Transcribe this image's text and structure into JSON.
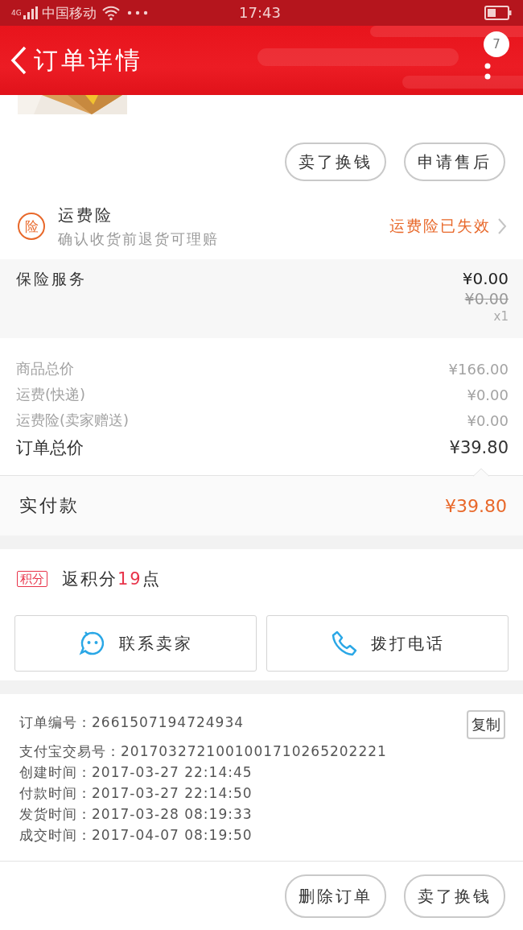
{
  "status_bar": {
    "network": "4G",
    "carrier": "中国移动",
    "time": "17:43"
  },
  "header": {
    "title": "订单详情",
    "badge": "7"
  },
  "top_actions": [
    "卖了换钱",
    "申请售后"
  ],
  "shipping_insurance": {
    "badge": "险",
    "title": "运费险",
    "subtitle": "确认收货前退货可理赔",
    "status": "运费险已失效"
  },
  "insurance_service": {
    "label": "保险服务",
    "price": "¥0.00",
    "original_price": "¥0.00",
    "quantity": "x1"
  },
  "price_lines": [
    {
      "label": "商品总价",
      "value": "¥166.00",
      "kind": "minor"
    },
    {
      "label": "运费(快递)",
      "value": "¥0.00",
      "kind": "minor"
    },
    {
      "label": "运费险(卖家赠送)",
      "value": "¥0.00",
      "kind": "minor"
    },
    {
      "label": "订单总价",
      "value": "¥39.80",
      "kind": "total"
    }
  ],
  "paid": {
    "label": "实付款",
    "value": "¥39.80"
  },
  "points": {
    "tag": "积分",
    "prefix": "返积分",
    "amount": "19",
    "suffix": "点"
  },
  "contact_buttons": [
    {
      "label": "联系卖家",
      "kind": "chat"
    },
    {
      "label": "拨打电话",
      "kind": "phone"
    }
  ],
  "order_info": {
    "copy_button": "复制",
    "lines": [
      "订单编号：2661507194724934",
      "支付宝交易号：2017032721001001710265202221",
      "创建时间：2017-03-27 22:14:45",
      "付款时间：2017-03-27 22:14:50",
      "发货时间：2017-03-28 08:19:33",
      "成交时间：2017-04-07 08:19:50"
    ]
  },
  "bottom_actions": [
    "删除订单",
    "卖了换钱"
  ]
}
